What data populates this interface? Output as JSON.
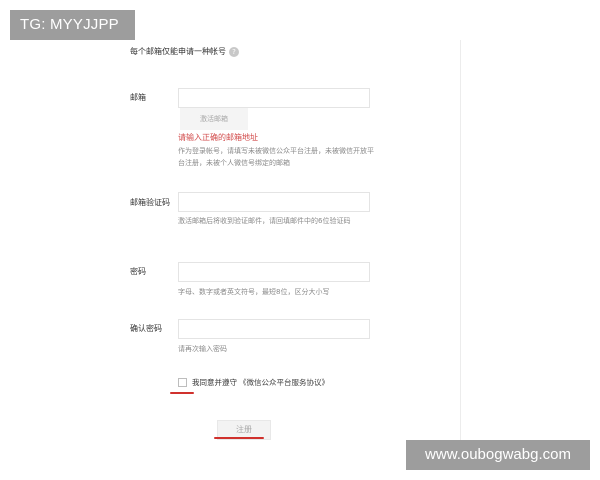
{
  "watermarks": {
    "top_left": "TG: MYYJJPP",
    "bottom_right": "www.oubogwabg.com"
  },
  "notice": {
    "text": "每个邮箱仅能申请一种帐号",
    "help_icon": "?"
  },
  "form": {
    "email": {
      "label": "邮箱",
      "value": "",
      "placeholder": "",
      "activate_button": "激活邮箱",
      "error": "请输入正确的邮箱地址",
      "hint": "作为登录帐号，请填写未被微信公众平台注册，未被微信开放平台注册，未被个人微信号绑定的邮箱"
    },
    "code": {
      "label": "邮箱验证码",
      "value": "",
      "hint": "激活邮箱后将收到验证邮件，请回填邮件中的6位验证码"
    },
    "password": {
      "label": "密码",
      "value": "",
      "hint": "字母、数字或者英文符号，最短8位，区分大小写"
    },
    "confirm_password": {
      "label": "确认密码",
      "value": "",
      "hint": "请再次输入密码"
    },
    "agreement": {
      "checked": false,
      "text": "我同意并遵守",
      "link": "《微信公众平台服务协议》"
    },
    "submit_label": "注册"
  },
  "colors": {
    "error": "#d24b4b",
    "annotation_underline": "#d0312d",
    "watermark_bg": "#9d9d9d"
  }
}
